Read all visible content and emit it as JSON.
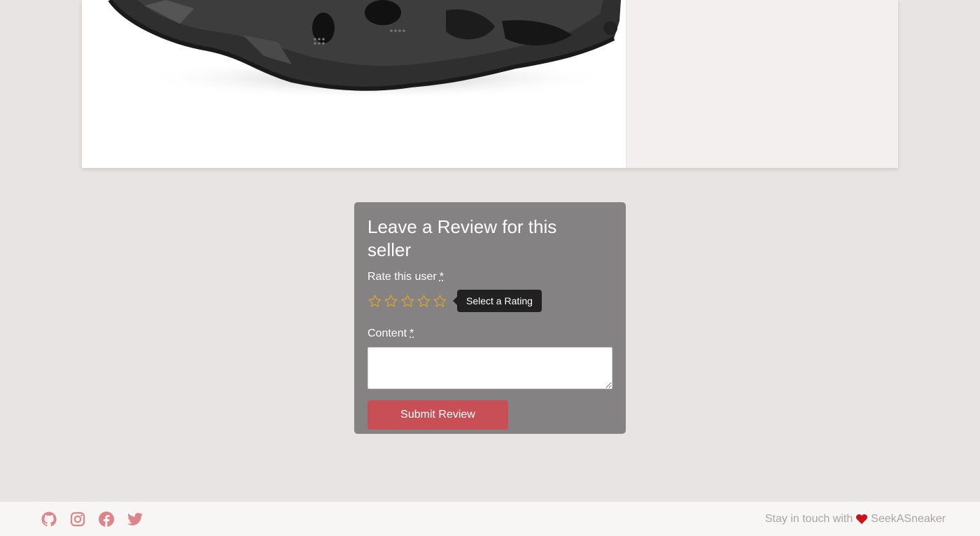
{
  "product": {
    "image_alt": "black sneaker"
  },
  "review_form": {
    "title": "Leave a Review for this seller",
    "rating_label": "Rate this user",
    "required_mark": "*",
    "stars_total": 5,
    "stars_selected": 0,
    "star_color": "#e0a428",
    "rating_tooltip": "Select a Rating",
    "content_label": "Content",
    "content_value": "",
    "submit_label": "Submit Review",
    "submit_color": "#c94f56"
  },
  "footer": {
    "social_icons": [
      "github-icon",
      "instagram-icon",
      "facebook-icon",
      "twitter-icon"
    ],
    "icon_color": "#de8589",
    "text_before": "Stay in touch with",
    "heart_color": "#c8141d",
    "brand": "SeekASneaker"
  }
}
